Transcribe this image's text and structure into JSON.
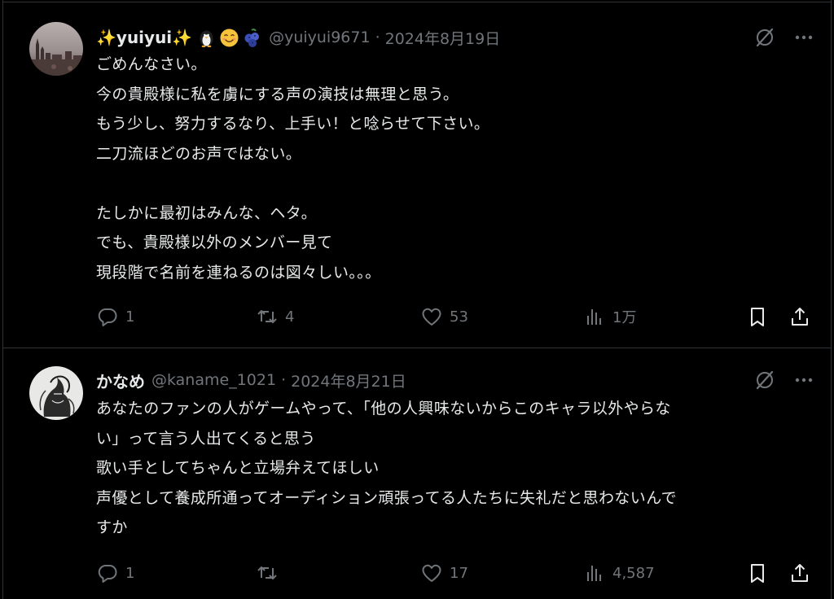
{
  "tweets": [
    {
      "display_name": "✨yuiyui✨",
      "badges": [
        "penguin-emoji",
        "smiling-face-emoji",
        "blueberries-emoji"
      ],
      "handle": "@yuiyui9671",
      "date": "2024年8月19日",
      "lines": [
        "ごめんなさい。",
        "今の貴殿様に私を虜にする声の演技は無理と思う。",
        "もう少し、努力するなり、上手い！と唸らせて下さい。",
        "二刀流ほどのお声ではない。",
        "",
        "たしかに最初はみんな、ヘタ。",
        "でも、貴殿様以外のメンバー見て",
        "現段階で名前を連ねるのは図々しい。。。"
      ],
      "replies": "1",
      "reposts": "4",
      "likes": "53",
      "views": "1万"
    },
    {
      "display_name": "かなめ",
      "badges": [],
      "handle": "@kaname_1021",
      "date": "2024年8月21日",
      "lines": [
        "あなたのファンの人がゲームやって、「他の人興味ないからこのキャラ以外やらな",
        "い」って言う人出てくると思う",
        "歌い手としてちゃんと立場弁えてほしい",
        "声優として養成所通ってオーディション頑張ってる人たちに失礼だと思わないんで",
        "すか"
      ],
      "replies": "1",
      "reposts": "",
      "likes": "17",
      "views": "4,587"
    }
  ],
  "separator": "·",
  "colors": {
    "background": "#000000",
    "text": "#e7e9ea",
    "secondary": "#71767b",
    "border": "#2f3336"
  },
  "icons": {
    "more": "more-horizontal-icon",
    "grok": "grok-icon",
    "reply": "reply-icon",
    "repost": "repost-icon",
    "like": "heart-icon",
    "views": "views-bar-chart-icon",
    "bookmark": "bookmark-icon",
    "share": "share-icon"
  }
}
